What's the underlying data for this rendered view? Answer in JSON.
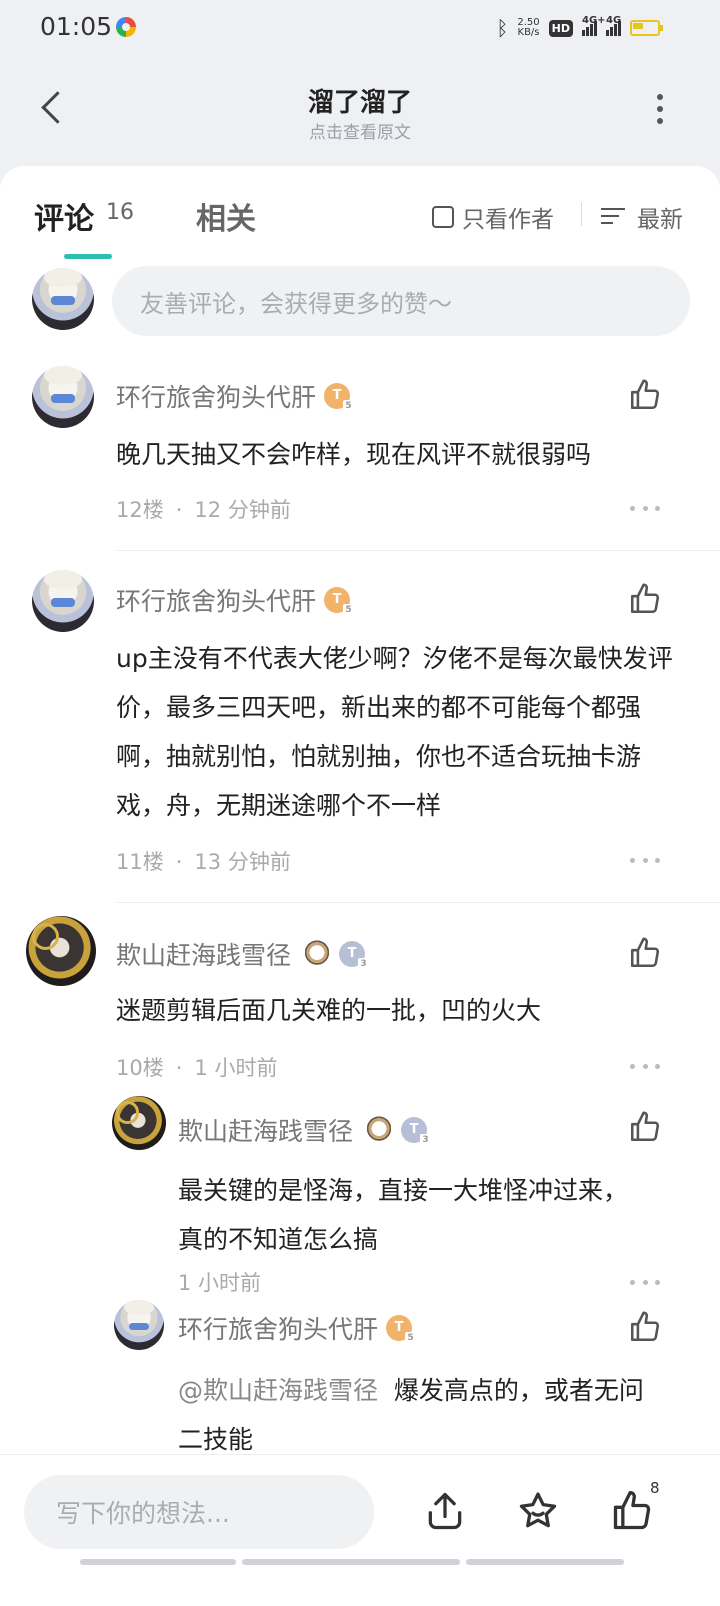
{
  "status": {
    "time": "01:05",
    "net_speed_value": "2.50",
    "net_speed_unit": "KB/s",
    "hd_label": "HD",
    "sig1_label": "4G+",
    "sig2_label": "4G"
  },
  "header": {
    "title": "溜了溜了",
    "subtitle": "点击查看原文"
  },
  "tabs": {
    "comments_label": "评论",
    "comments_count": "16",
    "related_label": "相关",
    "author_only_label": "只看作者",
    "sort_label": "最新"
  },
  "composer": {
    "placeholder": "友善评论，会获得更多的赞～"
  },
  "badges": {
    "gold_letter": "T",
    "silver_letter": "T",
    "level": "5",
    "level2": "3"
  },
  "comments": [
    {
      "username": "环行旅舍狗头代肝",
      "text": "晚几天抽又不会咋样，现在风评不就很弱吗",
      "floor": "12楼",
      "time": "12 分钟前"
    },
    {
      "username": "环行旅舍狗头代肝",
      "text": "up主没有不代表大佬少啊？汐佬不是每次最快发评价，最多三四天吧，新出来的都不可能每个都强啊，抽就别怕，怕就别抽，你也不适合玩抽卡游戏，舟，无期迷途哪个不一样",
      "floor": "11楼",
      "time": "13 分钟前"
    },
    {
      "username": "欺山赶海践雪径",
      "text": "迷题剪辑后面几关难的一批，凹的火大",
      "floor": "10楼",
      "time": "1 小时前"
    }
  ],
  "replies": [
    {
      "username": "欺山赶海践雪径",
      "text": "最关键的是怪海，直接一大堆怪冲过来，真的不知道怎么搞",
      "time": "1 小时前"
    },
    {
      "username": "环行旅舍狗头代肝",
      "mention": "@欺山赶海践雪径",
      "text": "爆发高点的，或者无问二技能"
    }
  ],
  "bottom": {
    "placeholder": "写下你的想法...",
    "like_count": "8"
  }
}
